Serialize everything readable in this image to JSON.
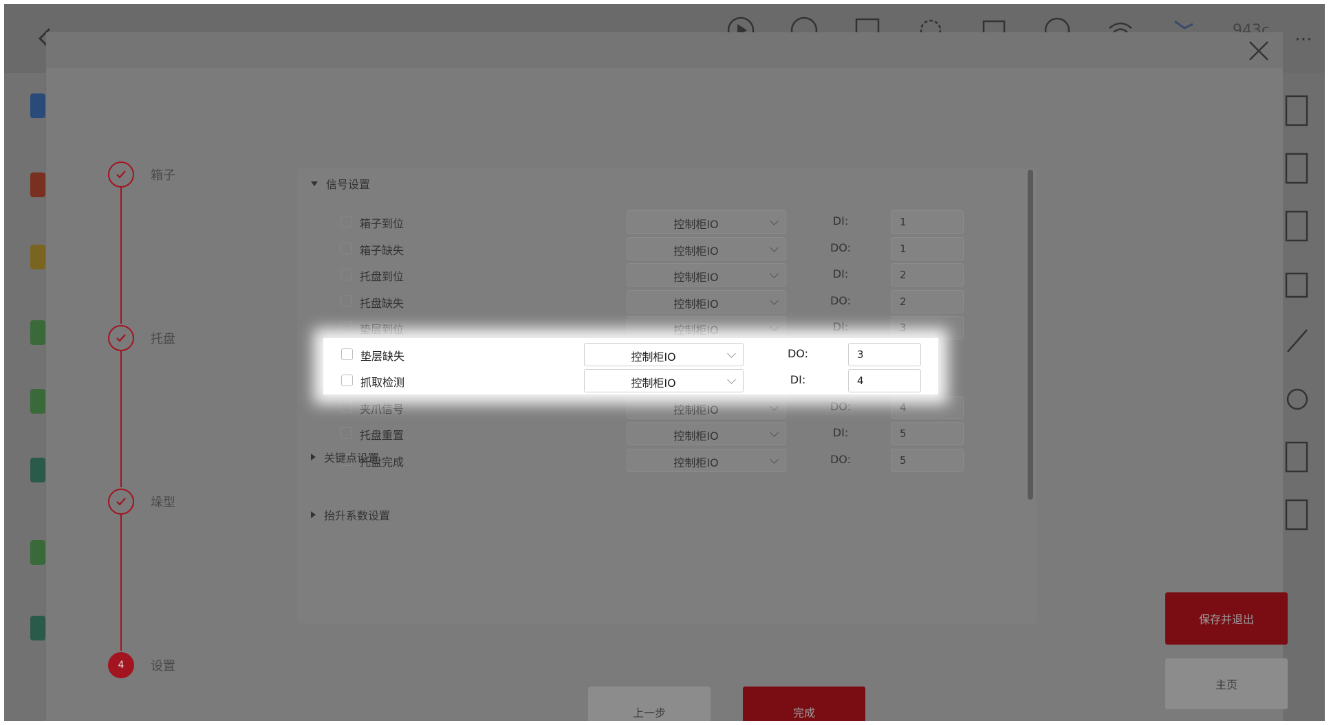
{
  "app": {
    "topbar_value": "943c",
    "more": "⋯",
    "icons": [
      "play-icon",
      "speed-icon",
      "window-icon",
      "gear-icon",
      "calendar-icon",
      "help-icon",
      "wifi-icon",
      "robot-arm-icon"
    ]
  },
  "steps": [
    {
      "label": "箱子",
      "state": "done"
    },
    {
      "label": "托盘",
      "state": "done"
    },
    {
      "label": "垛型",
      "state": "done"
    },
    {
      "label": "设置",
      "state": "active",
      "number": "4"
    }
  ],
  "sections": {
    "signal": "信号设置",
    "keypoint": "关键点设置",
    "lift": "抬升系数设置"
  },
  "rows": [
    {
      "label": "箱子到位",
      "source": "控制柜IO",
      "io": "DI:",
      "value": "1"
    },
    {
      "label": "箱子缺失",
      "source": "控制柜IO",
      "io": "DO:",
      "value": "1"
    },
    {
      "label": "托盘到位",
      "source": "控制柜IO",
      "io": "DI:",
      "value": "2"
    },
    {
      "label": "托盘缺失",
      "source": "控制柜IO",
      "io": "DO:",
      "value": "2"
    },
    {
      "label": "垫层到位",
      "source": "控制柜IO",
      "io": "DI:",
      "value": "3"
    },
    {
      "label": "垫层缺失",
      "source": "控制柜IO",
      "io": "DO:",
      "value": "3"
    },
    {
      "label": "抓取检测",
      "source": "控制柜IO",
      "io": "DI:",
      "value": "4"
    },
    {
      "label": "夹爪信号",
      "source": "控制柜IO",
      "io": "DO:",
      "value": "4"
    },
    {
      "label": "托盘重置",
      "source": "控制柜IO",
      "io": "DI:",
      "value": "5"
    },
    {
      "label": "托盘完成",
      "source": "控制柜IO",
      "io": "DO:",
      "value": "5"
    }
  ],
  "buttons": {
    "prev": "上一步",
    "done": "完成",
    "save_exit": "保存并退出",
    "home": "主页"
  },
  "colors": {
    "accent": "#b3121d",
    "overlay": "#7b7b7b"
  }
}
